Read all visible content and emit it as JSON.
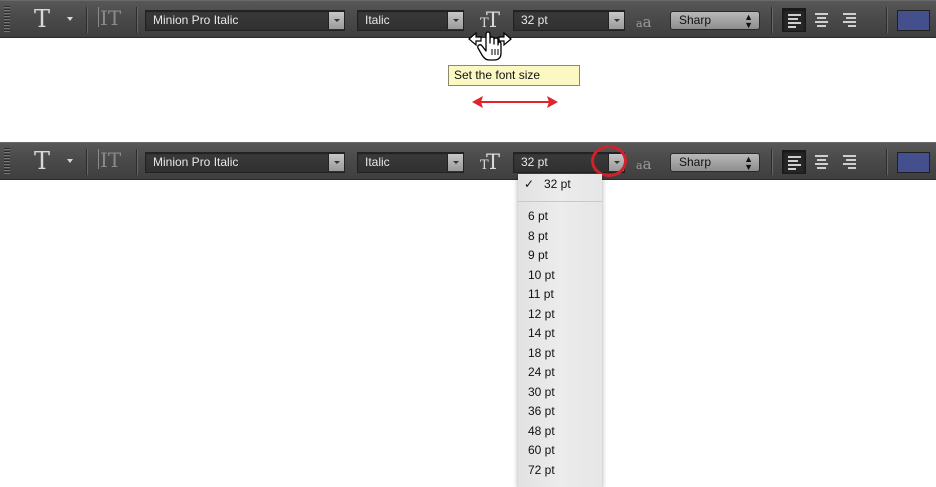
{
  "toolbar": {
    "type_tool_icon": "T",
    "orientation_icon": "IT",
    "font_family": "Minion Pro Italic",
    "font_style": "Italic",
    "font_size": "32 pt",
    "antialias_icon": "aa",
    "antialias": "Sharp",
    "alignment_selected": "left",
    "text_color": "#44508e"
  },
  "tooltip": {
    "text": "Set the font size"
  },
  "font_size_menu": {
    "selected": "32 pt",
    "options": [
      "6 pt",
      "8 pt",
      "9 pt",
      "10 pt",
      "11 pt",
      "12 pt",
      "14 pt",
      "18 pt",
      "24 pt",
      "30 pt",
      "36 pt",
      "48 pt",
      "60 pt",
      "72 pt"
    ]
  },
  "annotations": {
    "highlight_color": "#d0222b",
    "double_arrow_color": "#e0242c"
  }
}
